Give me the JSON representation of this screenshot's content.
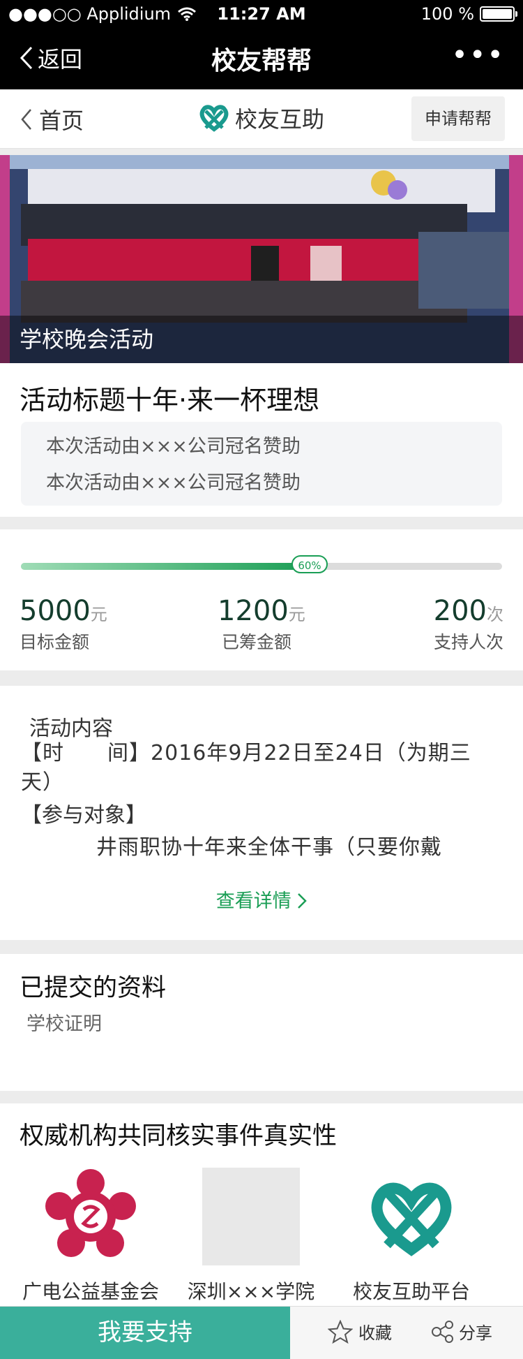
{
  "status_bar": {
    "carrier": "●●●○○ Applidium",
    "time": "11:27 AM",
    "battery": "100 %"
  },
  "nav": {
    "back_label": "返回",
    "title": "校友帮帮"
  },
  "subnav": {
    "home_label": "首页",
    "brand": "校友互助",
    "apply_label": "申请帮帮"
  },
  "banner": {
    "caption": "学校晚会活动"
  },
  "activity": {
    "title": "活动标题十年·来一杯理想",
    "sponsor_lines": [
      "本次活动由×××公司冠名赞助",
      "本次活动由×××公司冠名赞助"
    ]
  },
  "progress": {
    "percent": 60,
    "percent_label": "60%",
    "target": {
      "value": "5000",
      "unit": "元",
      "label": "目标金额"
    },
    "raised": {
      "value": "1200",
      "unit": "元",
      "label": "已筹金额"
    },
    "supporters": {
      "value": "200",
      "unit": "次",
      "label": "支持人次"
    }
  },
  "content": {
    "heading": "活动内容",
    "time_line": "【时　　间】2016年9月22日至24日（为期三天）",
    "audience_label": "【参与对象】",
    "audience_text": "井雨职协十年来全体干事（只要你戴",
    "more_label": "查看详情"
  },
  "docs": {
    "heading": "已提交的资料",
    "item": "学校证明"
  },
  "verify": {
    "heading": "权威机构共同核实事件真实性",
    "orgs": [
      {
        "name": "广电公益基金会",
        "icon": "foundation-flower-logo",
        "color": "#c8224f"
      },
      {
        "name": "深圳×××学院",
        "icon": "placeholder-logo",
        "color": "#e8e8e8"
      },
      {
        "name": "校友互助平台",
        "icon": "heart-ribbon-logo",
        "color": "#1a9a8e"
      }
    ]
  },
  "bottom": {
    "support_label": "我要支持",
    "favorite_label": "收藏",
    "share_label": "分享"
  },
  "colors": {
    "accent_green": "#1a9e55",
    "support_teal": "#3aaf9b",
    "brand_teal": "#1a9a8e"
  }
}
